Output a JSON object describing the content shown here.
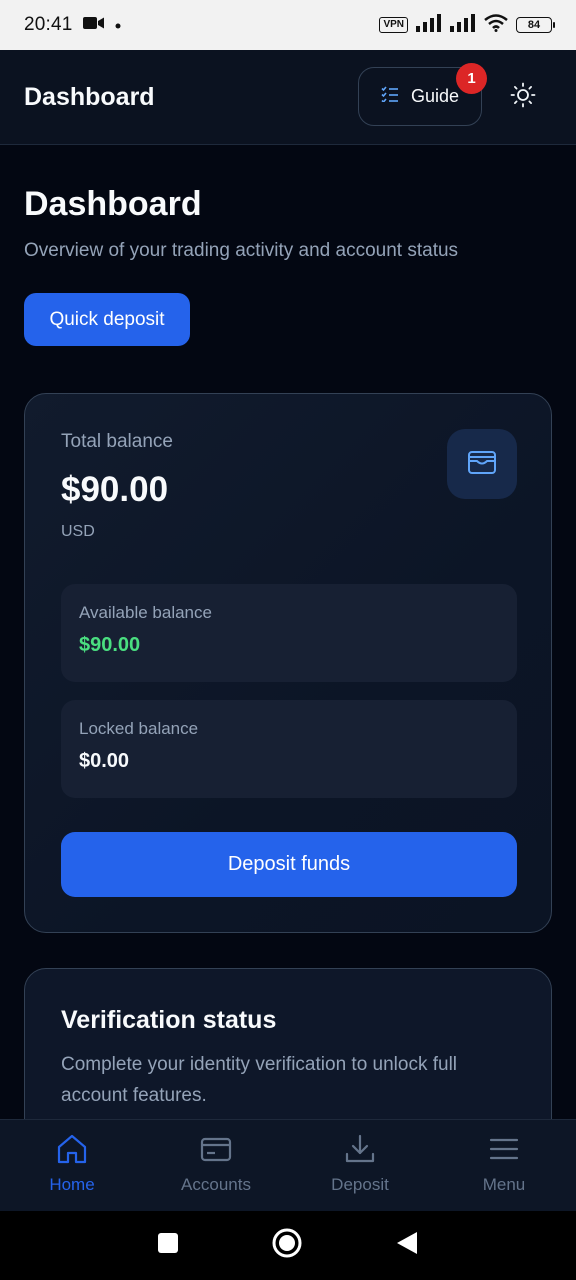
{
  "status_bar": {
    "time": "20:41",
    "vpn": "VPN",
    "battery": "84"
  },
  "header": {
    "title": "Dashboard",
    "guide_label": "Guide",
    "guide_badge": "1"
  },
  "page": {
    "title": "Dashboard",
    "subtitle": "Overview of your trading activity and account status",
    "quick_deposit": "Quick deposit"
  },
  "balance": {
    "label": "Total balance",
    "amount": "$90.00",
    "currency": "USD",
    "available_label": "Available balance",
    "available_value": "$90.00",
    "locked_label": "Locked balance",
    "locked_value": "$0.00",
    "deposit_button": "Deposit funds"
  },
  "verification": {
    "title": "Verification status",
    "text": "Complete your identity verification to unlock full account features."
  },
  "bottom_nav": {
    "items": [
      {
        "label": "Home",
        "icon": "home-icon",
        "active": true
      },
      {
        "label": "Accounts",
        "icon": "card-icon",
        "active": false
      },
      {
        "label": "Deposit",
        "icon": "download-icon",
        "active": false
      },
      {
        "label": "Menu",
        "icon": "menu-icon",
        "active": false
      }
    ]
  },
  "colors": {
    "background": "#030712",
    "accent": "#2563eb",
    "positive": "#4ade80",
    "badge": "#dc2626"
  }
}
